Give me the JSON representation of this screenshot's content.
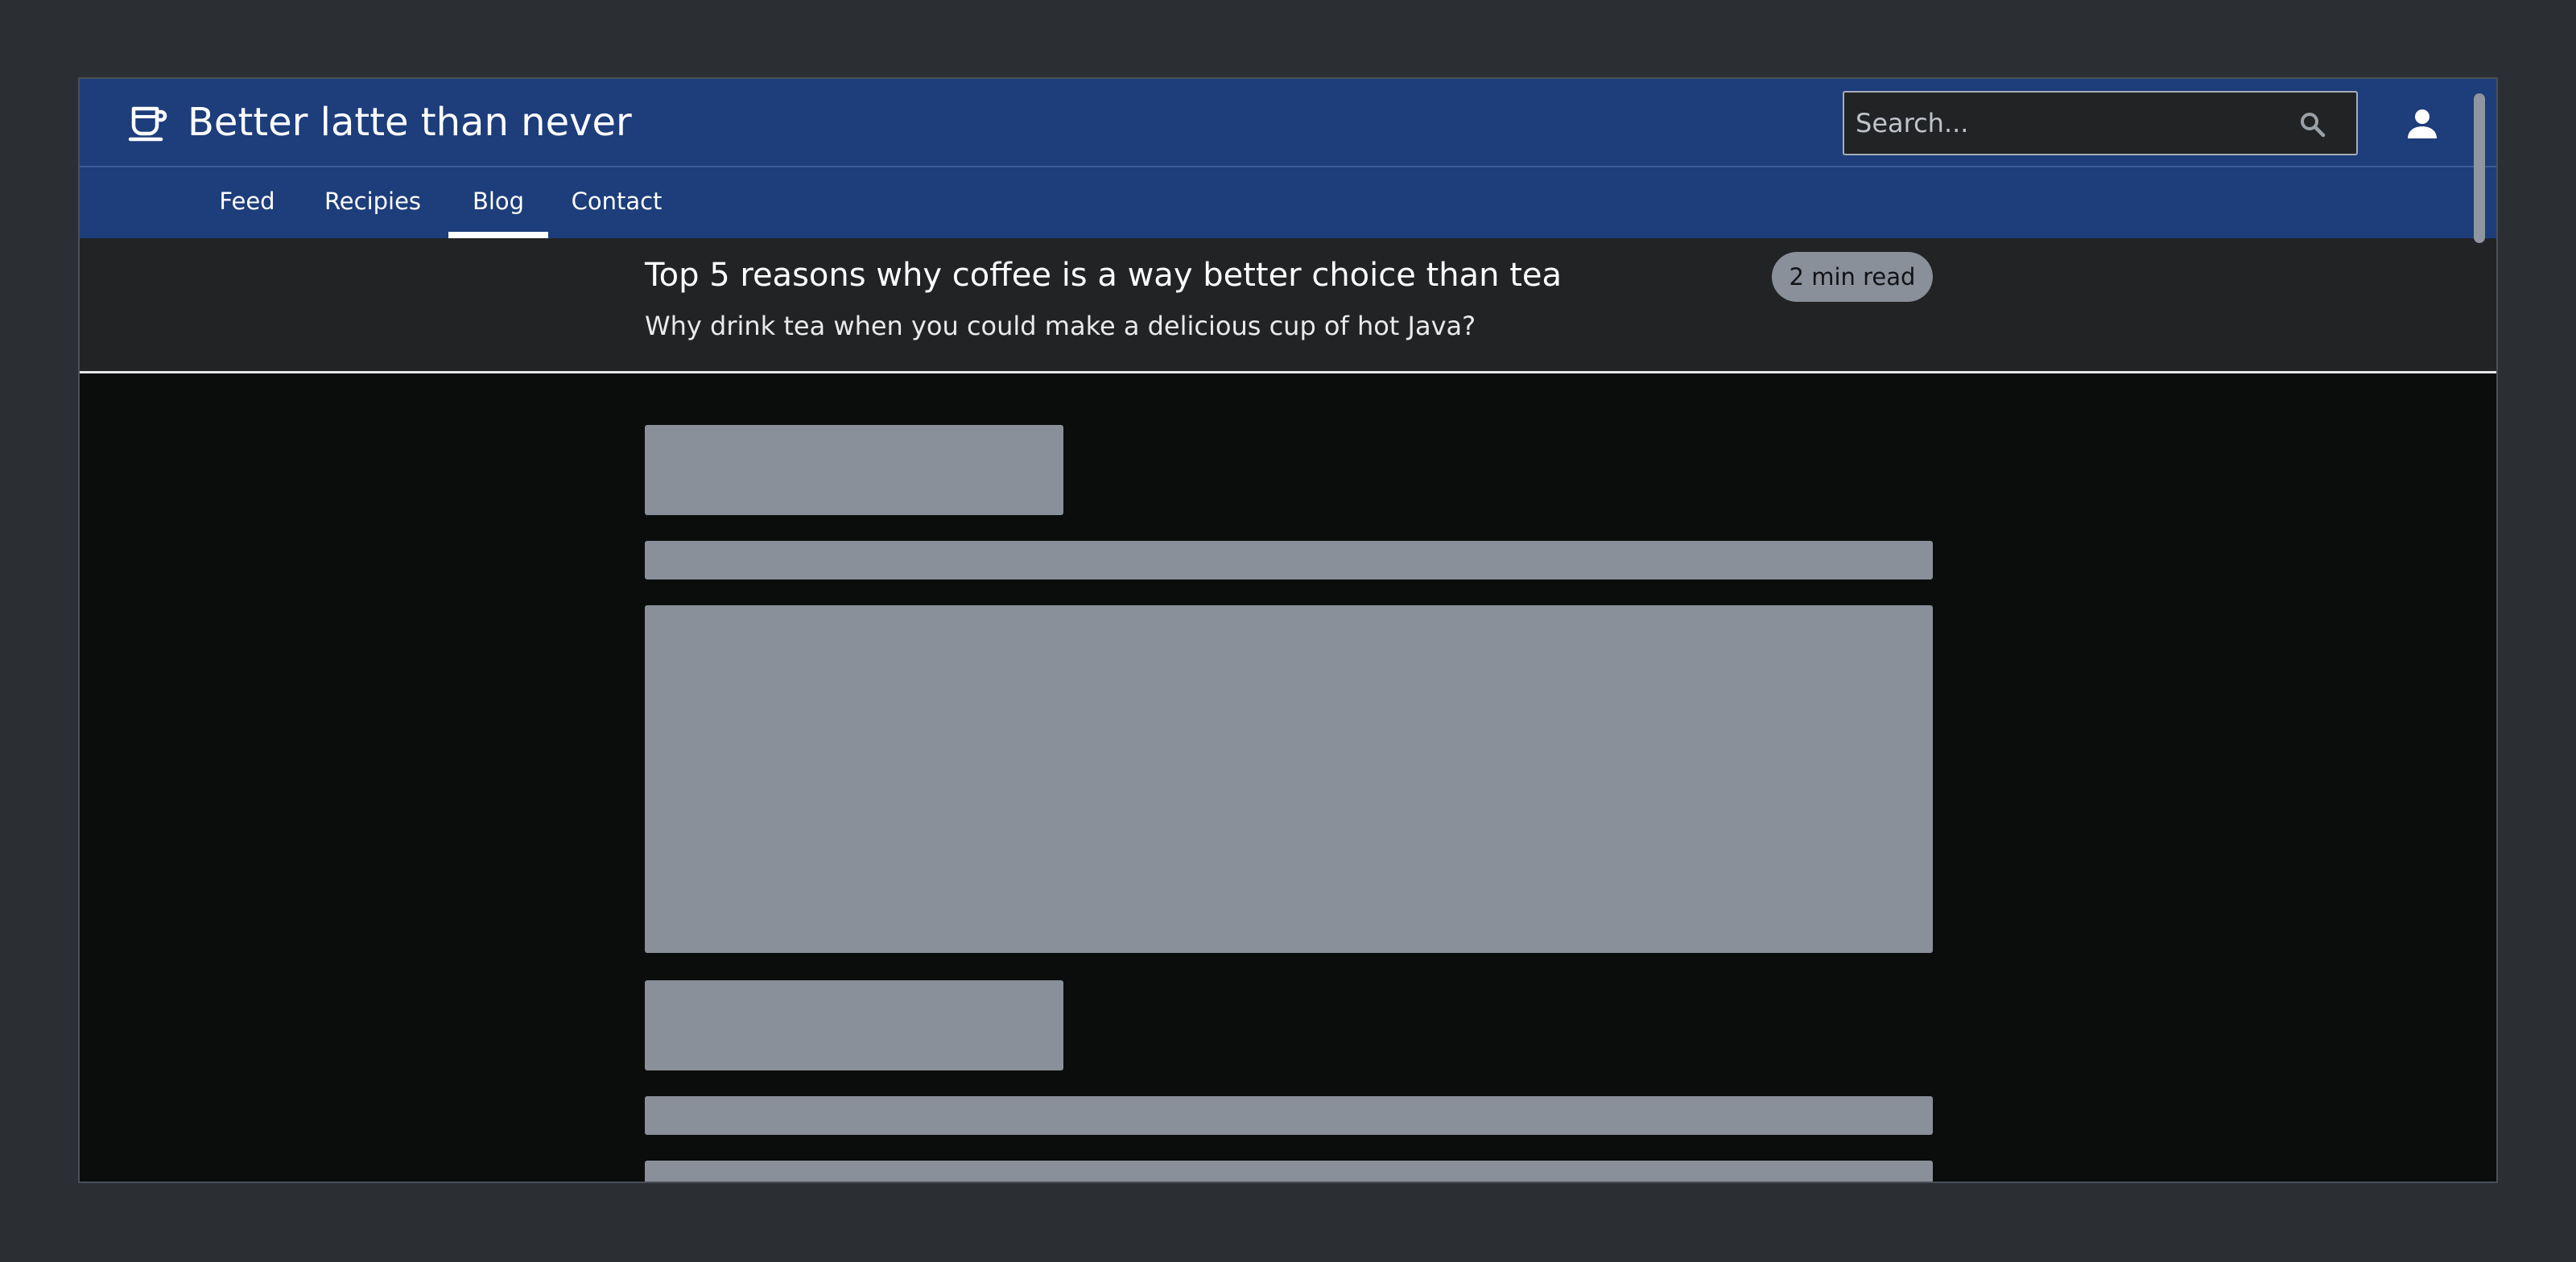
{
  "app": {
    "title": "Better latte than never",
    "logo_icon": "coffee-cup-icon",
    "user_icon": "account-icon"
  },
  "search": {
    "placeholder": "Search...",
    "value": "",
    "icon": "search-icon"
  },
  "nav": {
    "items": [
      {
        "label": "Feed",
        "active": false
      },
      {
        "label": "Recipies",
        "active": false
      },
      {
        "label": "Blog",
        "active": true
      },
      {
        "label": "Contact",
        "active": false
      }
    ]
  },
  "article": {
    "title": "Top 5 reasons why coffee is a way better choice than tea",
    "subtitle": "Why drink tea when you could make a delicious cup of hot Java?",
    "badge": "2 min read"
  },
  "colors": {
    "header_bg": "#1d3d7b",
    "article_header_bg": "#222325",
    "content_bg": "#0b0d0d",
    "skeleton": "#8a9099",
    "page_bg": "#2b2e33"
  }
}
